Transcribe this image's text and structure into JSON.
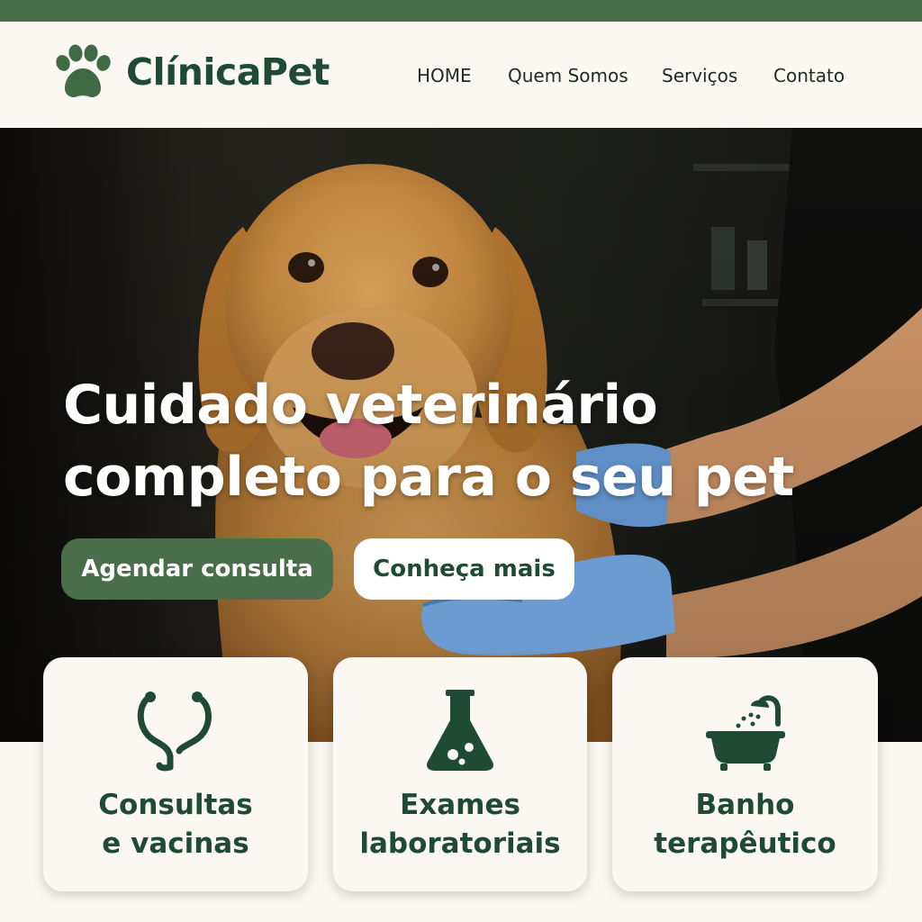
{
  "brand": {
    "name": "ClínicaPet",
    "logo_icon": "paw-icon",
    "colors": {
      "primary": "#4a6d4a",
      "dark_green": "#1f4a33",
      "background": "#fbf8f3"
    }
  },
  "nav": {
    "items": [
      {
        "label": "HOME"
      },
      {
        "label": "Quem Somos"
      },
      {
        "label": "Serviços"
      },
      {
        "label": "Contato"
      }
    ]
  },
  "hero": {
    "title_line1": "Cuidado veterinário",
    "title_line2": "completo para o seu pet",
    "image": "golden retriever being examined by a veterinarian wearing blue gloves",
    "primary_button": "Agendar consulta",
    "secondary_button": "Conheça mais"
  },
  "services": [
    {
      "icon": "stethoscope-icon",
      "line1": "Consultas",
      "line2": "e vacinas"
    },
    {
      "icon": "flask-icon",
      "line1": "Exames",
      "line2": "laboratoriais"
    },
    {
      "icon": "bathtub-icon",
      "line1": "Banho",
      "line2": "terapêutico"
    }
  ]
}
